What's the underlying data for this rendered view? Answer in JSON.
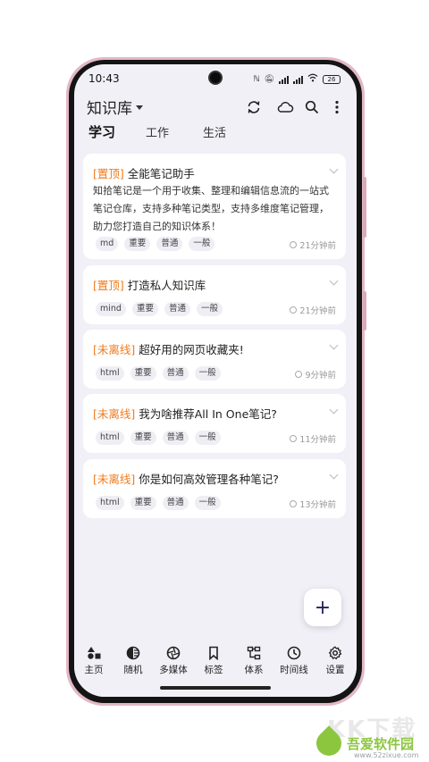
{
  "status_bar": {
    "time": "10:43",
    "battery": "26"
  },
  "header": {
    "library_title": "知识库"
  },
  "tabs": [
    {
      "label": "学习",
      "active": true
    },
    {
      "label": "工作",
      "active": false
    },
    {
      "label": "生活",
      "active": false
    }
  ],
  "notes": [
    {
      "tag": "[置顶]",
      "title": "全能笔记助手",
      "body": "知拾笔记是一个用于收集、整理和编辑信息流的一站式笔记仓库，支持多种笔记类型，支持多维度笔记管理，助力您打造自己的知识体系！",
      "chips": [
        "md",
        "重要",
        "普通",
        "一般"
      ],
      "time": "21分钟前"
    },
    {
      "tag": "[置顶]",
      "title": "打造私人知识库",
      "chips": [
        "mind",
        "重要",
        "普通",
        "一般"
      ],
      "time": "21分钟前"
    },
    {
      "tag": "[未离线]",
      "title": "超好用的网页收藏夹!",
      "chips": [
        "html",
        "重要",
        "普通",
        "一般"
      ],
      "time": "9分钟前"
    },
    {
      "tag": "[未离线]",
      "title": "我为啥推荐All In One笔记?",
      "chips": [
        "html",
        "重要",
        "普通",
        "一般"
      ],
      "time": "11分钟前"
    },
    {
      "tag": "[未离线]",
      "title": "你是如何高效管理各种笔记?",
      "chips": [
        "html",
        "重要",
        "普通",
        "一般"
      ],
      "time": "13分钟前"
    }
  ],
  "fab": {
    "symbol": "+"
  },
  "bottom_nav": [
    {
      "label": "主页",
      "icon": "shapes-icon"
    },
    {
      "label": "随机",
      "icon": "random-icon"
    },
    {
      "label": "多媒体",
      "icon": "aperture-icon"
    },
    {
      "label": "标签",
      "icon": "bookmark-icon"
    },
    {
      "label": "体系",
      "icon": "hierarchy-icon"
    },
    {
      "label": "时间线",
      "icon": "clock-icon"
    },
    {
      "label": "设置",
      "icon": "gear-icon"
    }
  ],
  "watermark": {
    "text": "吾爱软件园",
    "url": "www.52zixue.com",
    "big": "KK下载"
  },
  "colors": {
    "accent_tag": "#f07a1b",
    "background": "#f1f0f7",
    "frame": "#e3b8c6"
  }
}
